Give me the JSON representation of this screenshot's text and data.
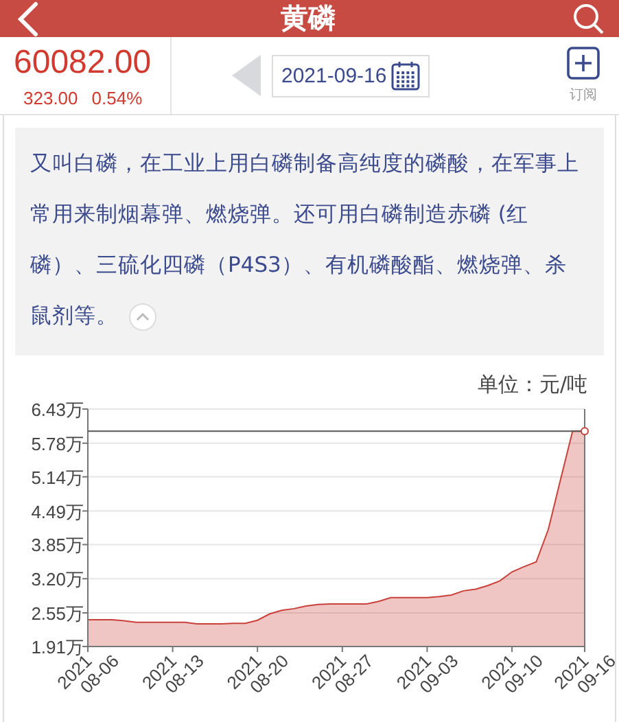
{
  "header": {
    "title": "黄磷"
  },
  "quote": {
    "price": "60082.00",
    "change": "323.00",
    "change_percent": "0.54%"
  },
  "date_picker": {
    "value": "2021-09-16"
  },
  "subscribe": {
    "label": "订阅"
  },
  "description": {
    "text": "又叫白磷，在工业上用白磷制备高纯度的磷酸，在军事上常用来制烟幕弹、燃烧弹。还可用白磷制造赤磷 (红磷）、三硫化四磷（P4S3）、有机磷酸酯、燃烧弹、杀鼠剂等。",
    "expanded": true
  },
  "chart": {
    "unit": "单位：元/吨",
    "chart_data": {
      "type": "area",
      "categories": [
        "2021\n08-06",
        null,
        null,
        null,
        null,
        null,
        null,
        "2021\n08-13",
        null,
        null,
        null,
        null,
        null,
        null,
        "2021\n08-20",
        null,
        null,
        null,
        null,
        null,
        null,
        "2021\n08-27",
        null,
        null,
        null,
        null,
        null,
        null,
        "2021\n09-03",
        null,
        null,
        null,
        null,
        null,
        null,
        "2021\n09-10",
        null,
        null,
        null,
        null,
        null,
        "2021\n09-16"
      ],
      "series": [
        {
          "color": "#c9413a",
          "values": [
            2.42,
            2.42,
            2.42,
            2.4,
            2.37,
            2.37,
            2.37,
            2.37,
            2.37,
            2.34,
            2.34,
            2.34,
            2.35,
            2.35,
            2.41,
            2.53,
            2.6,
            2.63,
            2.68,
            2.71,
            2.72,
            2.72,
            2.72,
            2.72,
            2.77,
            2.84,
            2.84,
            2.84,
            2.84,
            2.86,
            2.89,
            2.97,
            3.0,
            3.07,
            3.16,
            3.33,
            3.43,
            3.52,
            4.14,
            5.08,
            6.01,
            6.01
          ]
        }
      ],
      "ylim": [
        1.91,
        6.43
      ],
      "yticks": [
        {
          "value": 1.91,
          "label": "1.91万"
        },
        {
          "value": 2.55,
          "label": "2.55万"
        },
        {
          "value": 3.2,
          "label": "3.20万"
        },
        {
          "value": 3.85,
          "label": "3.85万"
        },
        {
          "value": 4.49,
          "label": "4.49万"
        },
        {
          "value": 5.14,
          "label": "5.14万"
        },
        {
          "value": 5.78,
          "label": "5.78万"
        },
        {
          "value": 6.43,
          "label": "6.43万"
        }
      ],
      "grid": true
    }
  }
}
